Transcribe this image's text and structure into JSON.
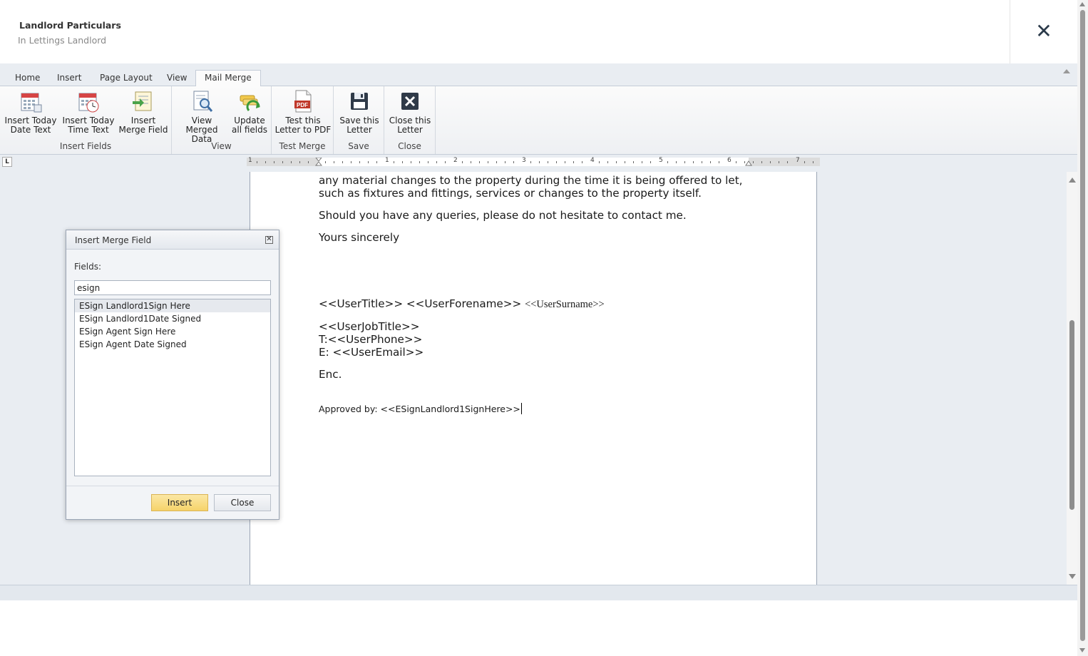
{
  "header": {
    "title": "Landlord Particulars",
    "subtitle": "In Lettings Landlord"
  },
  "ribbon": {
    "tabs": [
      {
        "label": "Home"
      },
      {
        "label": "Insert"
      },
      {
        "label": "Page Layout"
      },
      {
        "label": "View"
      },
      {
        "label": "Mail Merge"
      }
    ],
    "active_tab": "Mail Merge",
    "groups": [
      {
        "label": "Insert Fields",
        "buttons": [
          {
            "line1": "Insert Today",
            "line2": "Date Text",
            "icon": "calendar-icon"
          },
          {
            "line1": "Insert Today",
            "line2": "Time Text",
            "icon": "calendar-clock-icon"
          },
          {
            "line1": "Insert",
            "line2": "Merge Field",
            "icon": "merge-field-icon"
          }
        ]
      },
      {
        "label": "View",
        "buttons": [
          {
            "line1": "View Merged",
            "line2": "Data",
            "icon": "magnifier-document-icon"
          },
          {
            "line1": "Update",
            "line2": "all fields",
            "icon": "refresh-fields-icon"
          }
        ]
      },
      {
        "label": "Test Merge",
        "buttons": [
          {
            "line1": "Test this",
            "line2": "Letter to PDF",
            "icon": "pdf-icon",
            "icon_text": "PDF"
          }
        ]
      },
      {
        "label": "Save",
        "buttons": [
          {
            "line1": "Save this",
            "line2": "Letter",
            "icon": "floppy-disk-icon"
          }
        ]
      },
      {
        "label": "Close",
        "buttons": [
          {
            "line1": "Close this",
            "line2": "Letter",
            "icon": "close-box-icon"
          }
        ]
      }
    ]
  },
  "ruler": {
    "corner": "L",
    "numbers": [
      "1",
      "1",
      "2",
      "3",
      "4",
      "5",
      "6",
      "7"
    ]
  },
  "document": {
    "lines": [
      "any material changes to the property during the time it is being offered to let,",
      "such as fixtures and fittings, services or changes to the property itself.",
      "Should you have any queries, please do not hesitate to contact me.",
      "Yours sincerely"
    ],
    "signature_name_a": "<<UserTitle>> <<UserForename>> ",
    "signature_name_b": "<<UserSurname>>",
    "job_title": "<<UserJobTitle>>",
    "phone": "T:<<UserPhone>>",
    "email": "E: <<UserEmail>>",
    "enc": "Enc.",
    "approved": "Approved by: <<ESignLandlord1SignHere>>"
  },
  "dialog": {
    "title": "Insert Merge Field",
    "close_glyph": "✕",
    "fields_label": "Fields:",
    "search_value": "esign",
    "items": [
      "ESign Landlord1Sign Here",
      "ESign Landlord1Date Signed",
      "ESign Agent Sign Here",
      "ESign Agent Date Signed"
    ],
    "selected_index": 0,
    "insert_label": "Insert",
    "close_label": "Close"
  },
  "colors": {
    "ribbon_bg": "#e9edf2",
    "insert_button": "#f6d36a",
    "pdf_red": "#c0392b"
  }
}
